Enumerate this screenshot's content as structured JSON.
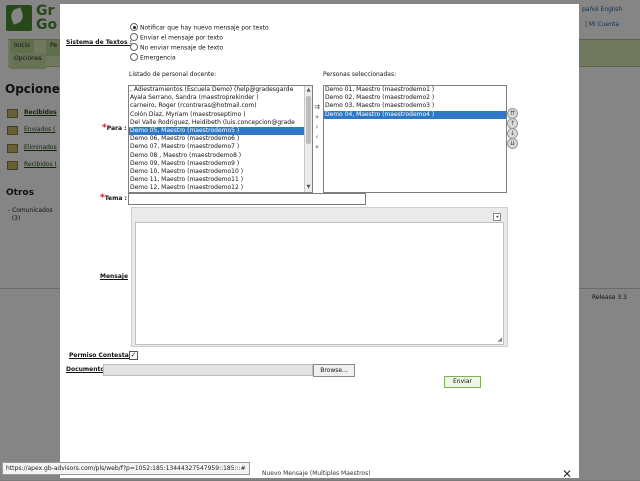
{
  "background": {
    "logo_text": "Gr\nGo",
    "top_links": "pañol  English",
    "top_links2": "| Mi Cuenta",
    "tabs": [
      "Inicio",
      "Pe"
    ],
    "subtab": "Opciones",
    "title": "Opciones",
    "side_items": [
      "Recibidos",
      "Enviados (",
      "Eliminados",
      "Recibidos I"
    ],
    "otros": "Otros",
    "comunicados": "- Comunicados\n  (3)",
    "release": "Release 3.3"
  },
  "form": {
    "sms_label": "Sistema de Textos :",
    "sms_options": [
      {
        "label": "Notificar que hay nuevo mensaje por texto",
        "selected": true
      },
      {
        "label": "Enviar el mensaje por texto",
        "selected": false
      },
      {
        "label": "No enviar mensaje de texto",
        "selected": false
      },
      {
        "label": "Emergencia",
        "selected": false
      }
    ],
    "staff_list_label": "Listado de personal docente:",
    "selected_list_label": "Personas seleccionadas:",
    "para_label": "Para :",
    "staff": [
      {
        "text": ", Adiestramientos (Escuela Demo) (help@gradesgarde",
        "selected": false
      },
      {
        "text": "Ayala Serrano, Sandra (maestroprekinder )",
        "selected": false
      },
      {
        "text": "carneiro, Roger (rcontreras@hotmail.com)",
        "selected": false
      },
      {
        "text": "Colón Díaz, Myriam (maestroseptimo )",
        "selected": false
      },
      {
        "text": "Del Valle Rodriguez, Heidibeth (luis.concepcion@grade",
        "selected": false
      },
      {
        "text": "Demo 05, Maestro (maestrodemo5 )",
        "selected": true
      },
      {
        "text": "Demo 06, Maestro (maestrodemo6 )",
        "selected": false
      },
      {
        "text": "Demo 07, Maestro (maestrodemo7 )",
        "selected": false
      },
      {
        "text": "Demo 08 , Maestro (maestrodemo8 )",
        "selected": false
      },
      {
        "text": "Demo 09, Maestro (maestrodemo9 )",
        "selected": false
      },
      {
        "text": "Demo 10, Maestro (maestrodemo10 )",
        "selected": false
      },
      {
        "text": "Demo 11, Maestro (maestrodemo11 )",
        "selected": false
      },
      {
        "text": "Demo 12, Maestro (maestrodemo12 )",
        "selected": false
      }
    ],
    "selected_people": [
      {
        "text": "Demo 01, Maestro (maestrodemo1 )",
        "selected": false
      },
      {
        "text": "Demo 02, Maestro (maestrodemo2 )",
        "selected": false
      },
      {
        "text": "Demo 03, Maestro (maestrodemo3 )",
        "selected": false
      },
      {
        "text": "Demo 04, Maestro (maestrodemo4 )",
        "selected": true
      }
    ],
    "move_buttons": [
      "⇉",
      "»",
      "›",
      "‹",
      "«"
    ],
    "order_buttons": [
      "⇈",
      "↑",
      "↓",
      "⇊"
    ],
    "tema_label": "Tema :",
    "tema_value": "",
    "mensaje_label": "Mensaje",
    "editor_toolbar_icon": "◂",
    "editor_grip": "◢",
    "permiso_label": "Permiso Contestar",
    "permiso_checked": true,
    "check_mark": "✓",
    "documento_label": "Documento",
    "browse_label": "Browse...",
    "send_label": "Enviar",
    "required_mark": "*"
  },
  "dialog": {
    "footer_title": "Nuevo Mensaje (Multiples Maestros)",
    "close_glyph": "✕"
  },
  "status_url": "https://apex.gb-advisors.com/pls/web/f?p=1052:185:13444327547959::185:::#"
}
